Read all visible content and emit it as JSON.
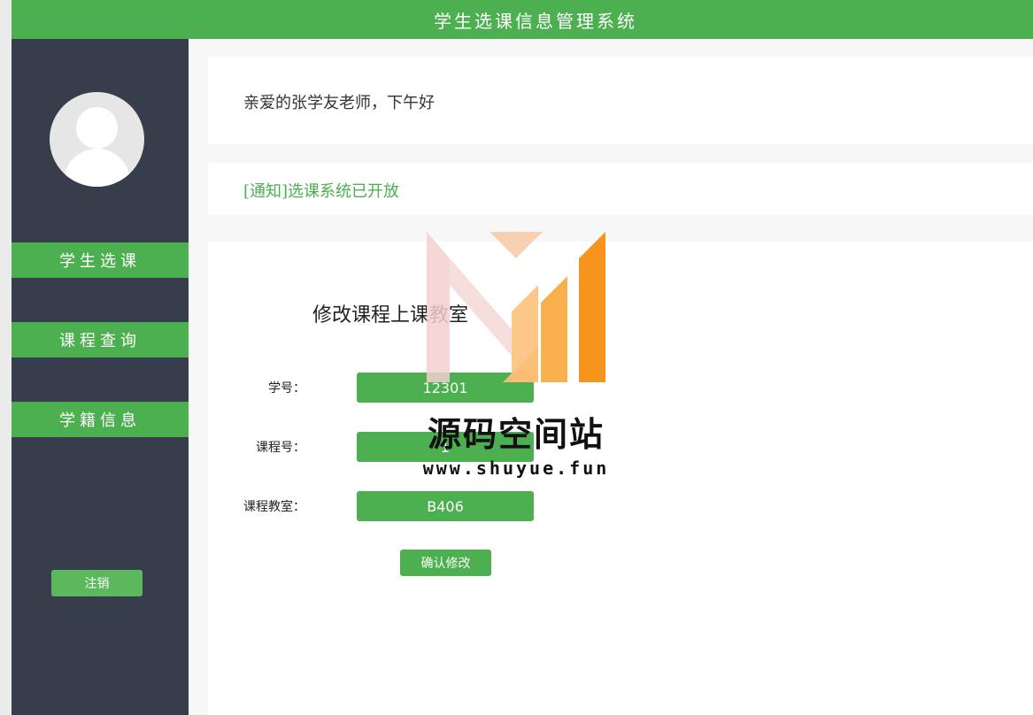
{
  "header": {
    "title": "学生选课信息管理系统"
  },
  "sidebar": {
    "items": [
      {
        "label": "学生选课"
      },
      {
        "label": "课程查询"
      },
      {
        "label": "学籍信息"
      }
    ],
    "logout_label": "注销"
  },
  "greeting": "亲爱的张学友老师，下午好",
  "notice": "[通知]选课系统已开放",
  "form": {
    "title": "修改课程上课教室",
    "fields": [
      {
        "label": "学号：",
        "value": "12301"
      },
      {
        "label": "课程号：",
        "value": "1"
      },
      {
        "label": "课程教室：",
        "value": "B406"
      }
    ],
    "submit_label": "确认修改"
  },
  "watermark": {
    "title": "源码空间站",
    "url": "www.shuyue.fun"
  },
  "colors": {
    "accent": "#4caf50",
    "sidebar_bg": "#373d4a",
    "watermark_peach": "#f5c9a6",
    "watermark_pink": "#f2d0cf",
    "watermark_orange": "#f7941d"
  }
}
